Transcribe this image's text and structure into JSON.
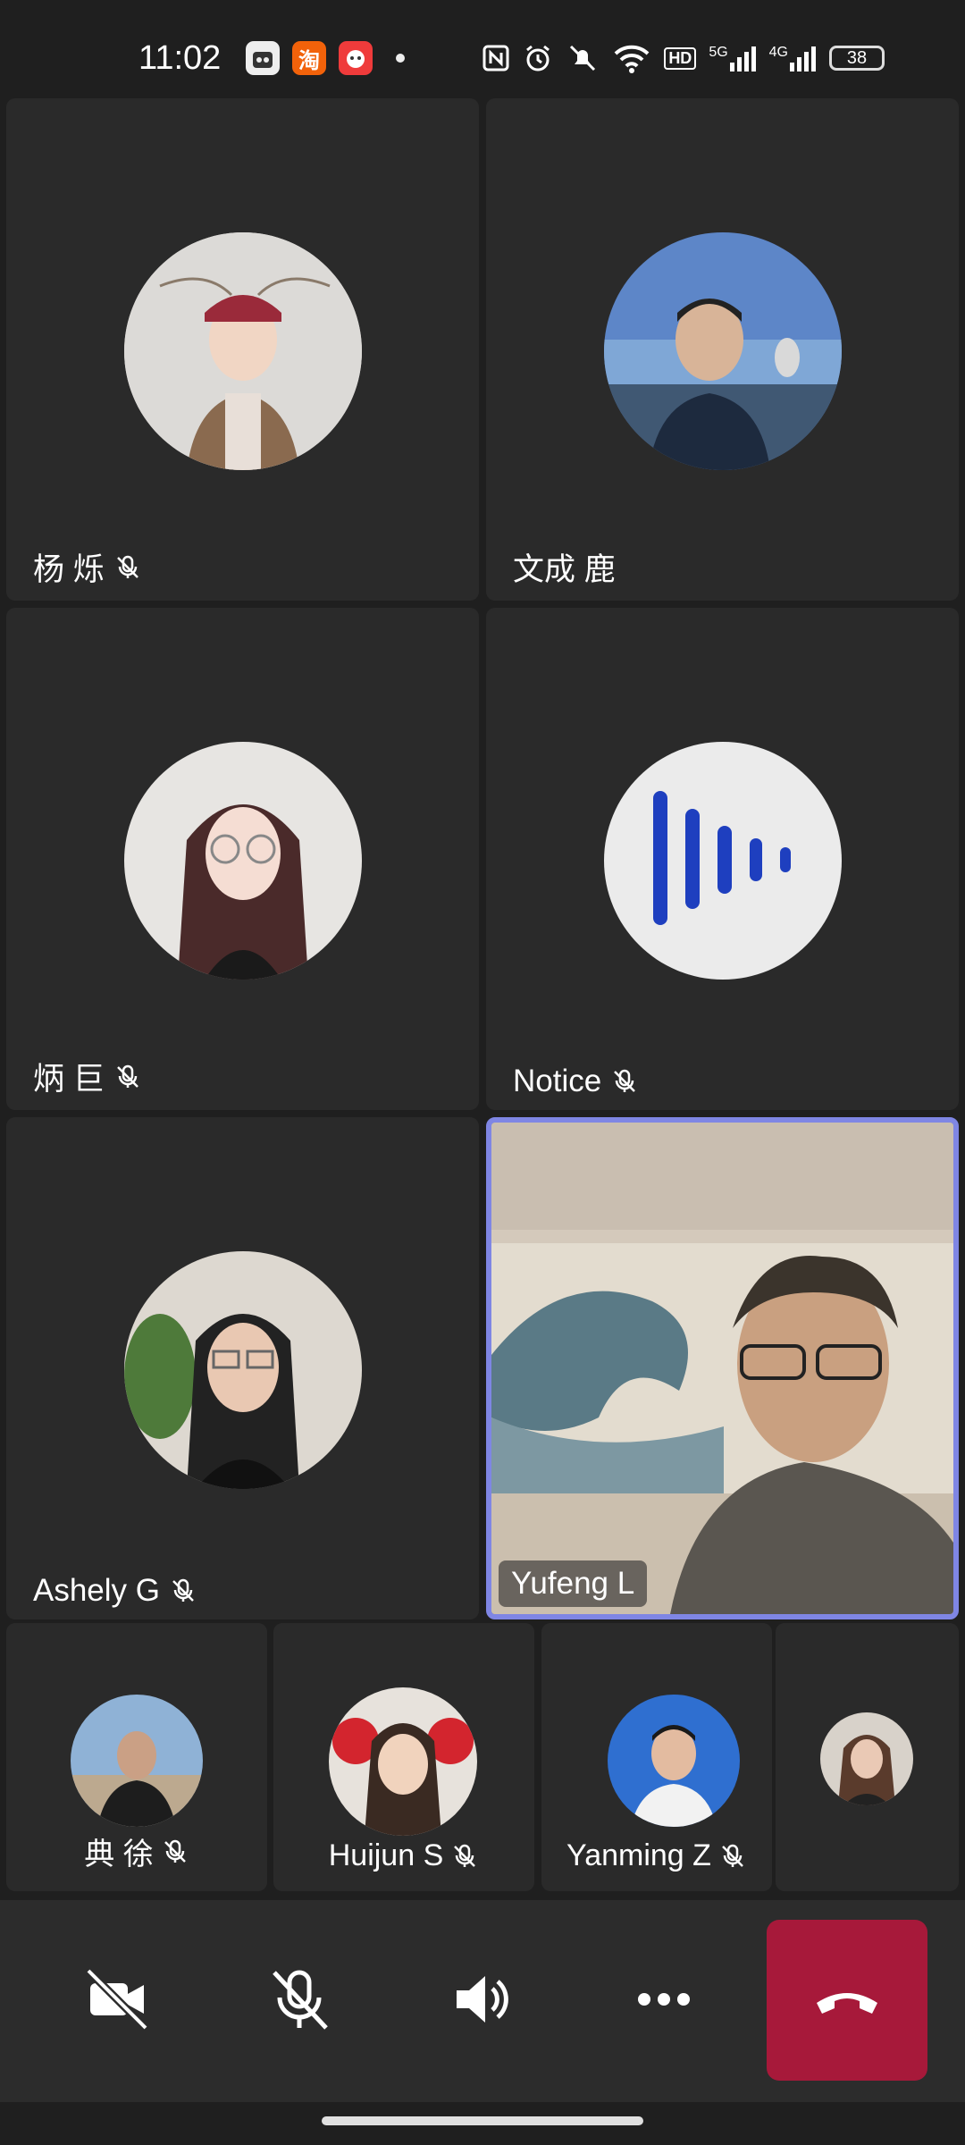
{
  "status_bar": {
    "time": "11:02",
    "notification_icons": [
      "app-icon",
      "taobao-icon",
      "red-app-icon"
    ],
    "taobao_glyph": "淘",
    "network_5g": "5G",
    "network_4g": "4G",
    "hd_badge": "HD",
    "battery": "38"
  },
  "participants": [
    {
      "name": "杨 烁",
      "muted": true
    },
    {
      "name": "文成 鹿",
      "muted": false
    },
    {
      "name": "炳 巨",
      "muted": true
    },
    {
      "name": "Notice",
      "muted": true
    },
    {
      "name": "Ashely G",
      "muted": true
    },
    {
      "name": "Yufeng L",
      "muted": false,
      "active_speaker": true
    }
  ],
  "strip": [
    {
      "name": "典 徐",
      "muted": true
    },
    {
      "name": "Huijun S",
      "muted": true
    },
    {
      "name": "Yanming Z",
      "muted": true
    },
    {
      "name": "",
      "muted": false
    }
  ],
  "controls": {
    "camera": "camera-off-icon",
    "mic": "mic-off-icon",
    "speaker": "speaker-icon",
    "more": "more-icon",
    "end_call": "hang-up-icon"
  },
  "colors": {
    "background": "#1f1f1f",
    "tile": "#2a2a2a",
    "active_border": "#7f86e4",
    "end_call": "#a7193a"
  }
}
